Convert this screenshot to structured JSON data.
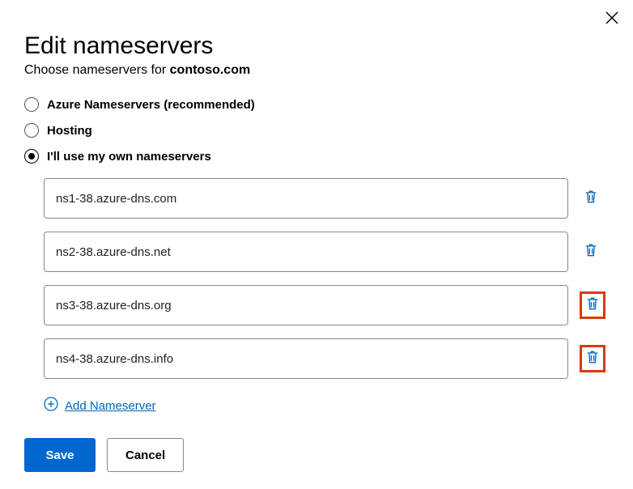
{
  "header": {
    "title": "Edit nameservers",
    "subtitle_prefix": "Choose nameservers for ",
    "domain": "contoso.com"
  },
  "radio_options": {
    "azure": "Azure Nameservers (recommended)",
    "hosting": "Hosting",
    "own": "I'll use my own nameservers",
    "selected": "own"
  },
  "nameservers": [
    {
      "value": "ns1-38.azure-dns.com",
      "highlight": false
    },
    {
      "value": "ns2-38.azure-dns.net",
      "highlight": false
    },
    {
      "value": "ns3-38.azure-dns.org",
      "highlight": true
    },
    {
      "value": "ns4-38.azure-dns.info",
      "highlight": true
    }
  ],
  "add_link": "Add Nameserver",
  "buttons": {
    "save": "Save",
    "cancel": "Cancel"
  },
  "colors": {
    "link": "#0067b8",
    "primary": "#0067d0",
    "highlight_border": "#d83b01"
  }
}
